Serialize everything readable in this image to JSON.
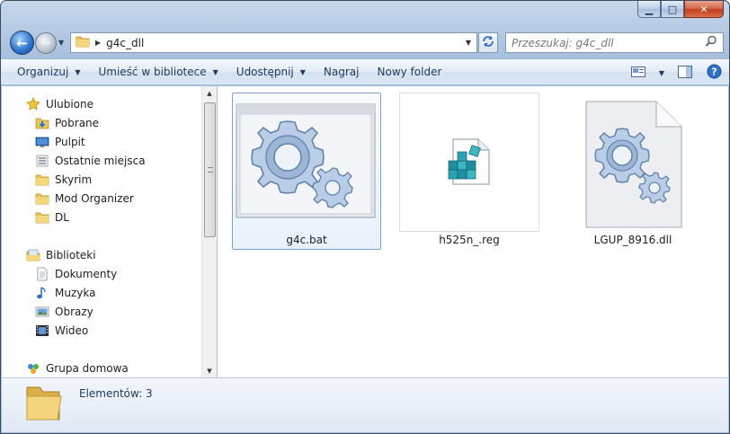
{
  "window": {
    "caption": {
      "minimize": "▁",
      "maximize": "□",
      "close": "✕"
    }
  },
  "address_bar": {
    "crumb": "g4c_dll",
    "search_placeholder": "Przeszukaj: g4c_dll"
  },
  "toolbar": {
    "organize": "Organizuj",
    "include_library": "Umieść w bibliotece",
    "share": "Udostępnij",
    "burn": "Nagraj",
    "new_folder": "Nowy folder"
  },
  "nav": {
    "favorites": "Ulubione",
    "favorites_items": [
      "Pobrane",
      "Pulpit",
      "Ostatnie miejsca",
      "Skyrim",
      "Mod Organizer",
      "DL"
    ],
    "libraries": "Biblioteki",
    "libraries_items": [
      "Dokumenty",
      "Muzyka",
      "Obrazy",
      "Wideo"
    ],
    "homegroup": "Grupa domowa"
  },
  "files": [
    {
      "name": "g4c.bat",
      "type": "batch"
    },
    {
      "name": "h525n_.reg",
      "type": "registry"
    },
    {
      "name": "LGUP_8916.dll",
      "type": "dll"
    }
  ],
  "status": {
    "count_text": "Elementów: 3"
  },
  "colors": {
    "accent": "#2a6fc9",
    "selection_border": "#7da2ce",
    "close_button": "#c2401f"
  }
}
